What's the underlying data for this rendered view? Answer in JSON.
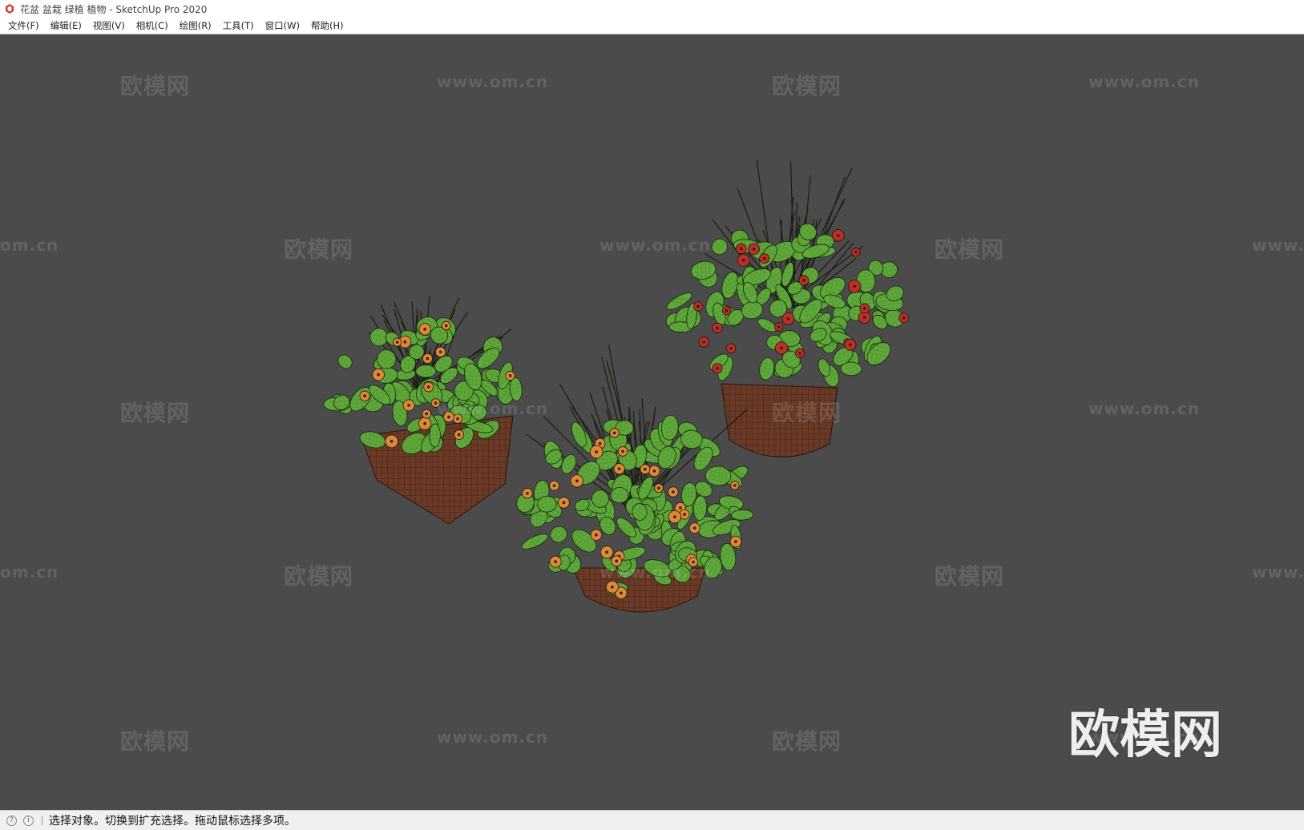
{
  "window": {
    "title": "花盆 盆栽 绿植 植物 - SketchUp Pro 2020"
  },
  "menu": {
    "items": [
      {
        "label": "文件(F)"
      },
      {
        "label": "编辑(E)"
      },
      {
        "label": "视图(V)"
      },
      {
        "label": "相机(C)"
      },
      {
        "label": "绘图(R)"
      },
      {
        "label": "工具(T)"
      },
      {
        "label": "窗口(W)"
      },
      {
        "label": "帮助(H)"
      }
    ]
  },
  "viewport": {
    "background": "#4b4b4b",
    "watermark_cn": "欧模网",
    "watermark_url": "www.om.cn",
    "watermark_url_partial_left": "om.cn",
    "watermark_url_partial_right": "www.",
    "logo_text": "欧模网"
  },
  "status": {
    "text": "选择对象。切换到扩充选择。拖动鼠标选择多项。"
  },
  "colors": {
    "leaf": "#5fa83a",
    "pot": "#6b3a26",
    "flower_orange": "#d88a3a",
    "flower_red": "#b8302a"
  }
}
